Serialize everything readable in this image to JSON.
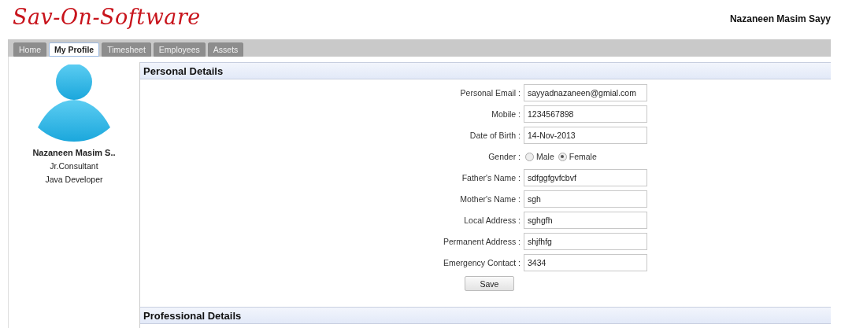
{
  "header": {
    "logo": "Sav-On-Software",
    "user_name": "Nazaneen Masim Sayy"
  },
  "tabs": [
    {
      "label": "Home",
      "selected": false
    },
    {
      "label": "My Profile",
      "selected": true
    },
    {
      "label": "Timesheet",
      "selected": false
    },
    {
      "label": "Employees",
      "selected": false
    },
    {
      "label": "Assets",
      "selected": false
    }
  ],
  "sidebar": {
    "name": "Nazaneen Masim S..",
    "designation": "Jr.Consultant",
    "role": "Java Developer"
  },
  "personal_details": {
    "title": "Personal Details",
    "fields": [
      {
        "kind": "text",
        "label": "Personal Email :",
        "value": "sayyadnazaneen@gmial.com"
      },
      {
        "kind": "text",
        "label": "Mobile :",
        "value": "1234567898"
      },
      {
        "kind": "text",
        "label": "Date of Birth :",
        "value": "14-Nov-2013"
      },
      {
        "kind": "radio",
        "label": "Gender :",
        "options": [
          {
            "label": "Male",
            "selected": false
          },
          {
            "label": "Female",
            "selected": true
          }
        ]
      },
      {
        "kind": "text",
        "label": "Father's Name :",
        "value": "sdfggfgvfcbvf"
      },
      {
        "kind": "text",
        "label": "Mother's Name :",
        "value": "sgh"
      },
      {
        "kind": "text",
        "label": "Local Address :",
        "value": "sghgfh"
      },
      {
        "kind": "text",
        "label": "Permanent Address :",
        "value": "shjfhfg"
      },
      {
        "kind": "text",
        "label": "Emergency Contact :",
        "value": "3434"
      }
    ],
    "save_button": "Save"
  },
  "professional_details": {
    "title": "Professional Details"
  }
}
